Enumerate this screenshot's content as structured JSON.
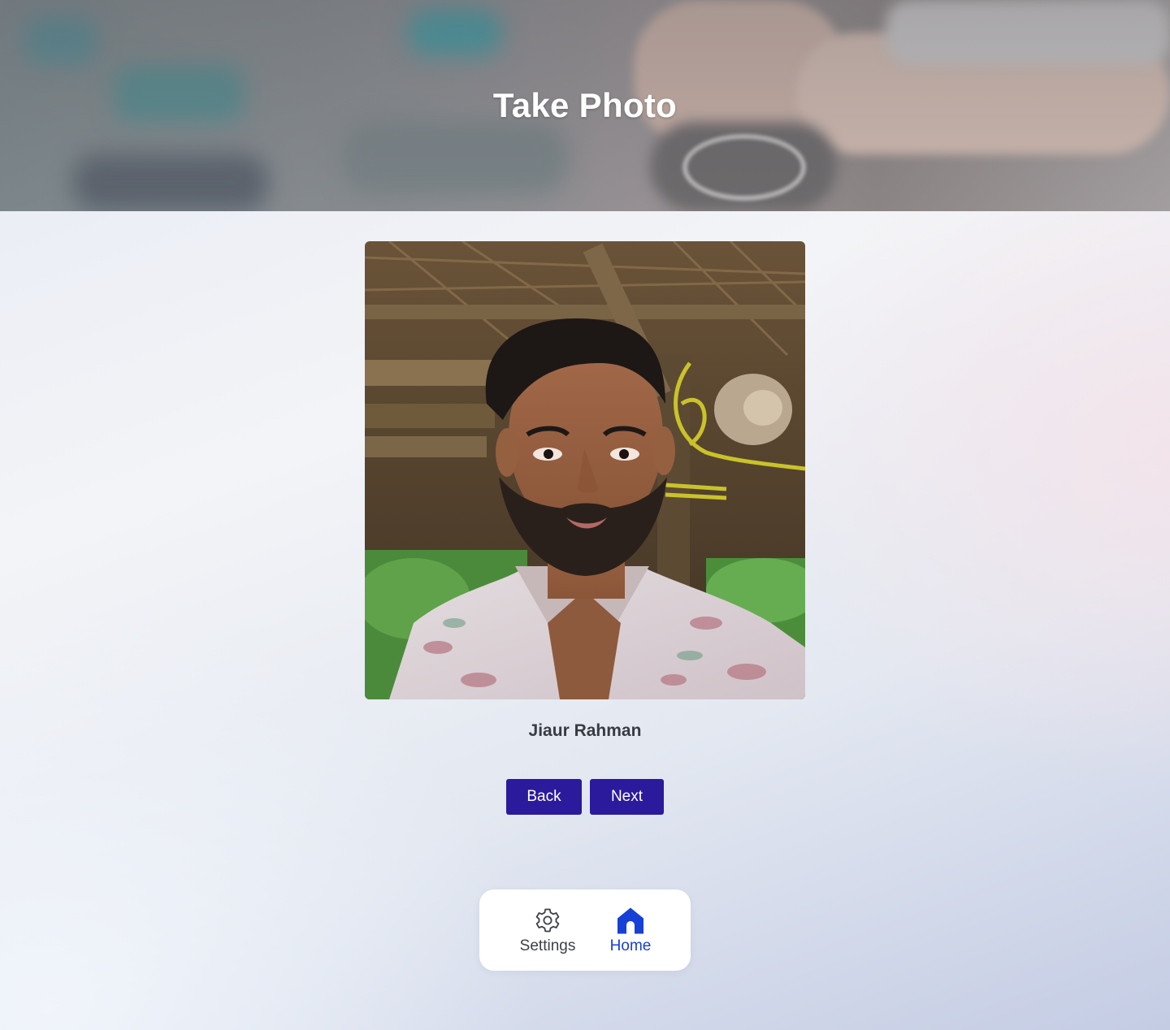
{
  "header": {
    "title": "Take Photo"
  },
  "profile": {
    "name": "Jiaur Rahman"
  },
  "actions": {
    "back_label": "Back",
    "next_label": "Next"
  },
  "bottom_nav": {
    "items": [
      {
        "label": "Settings",
        "icon": "gear-icon",
        "active": false
      },
      {
        "label": "Home",
        "icon": "home-icon",
        "active": true
      }
    ]
  },
  "colors": {
    "button": "#2b1a9c",
    "nav_active": "#1740d6",
    "nav_inactive": "#3d4047",
    "title": "#ffffff"
  }
}
